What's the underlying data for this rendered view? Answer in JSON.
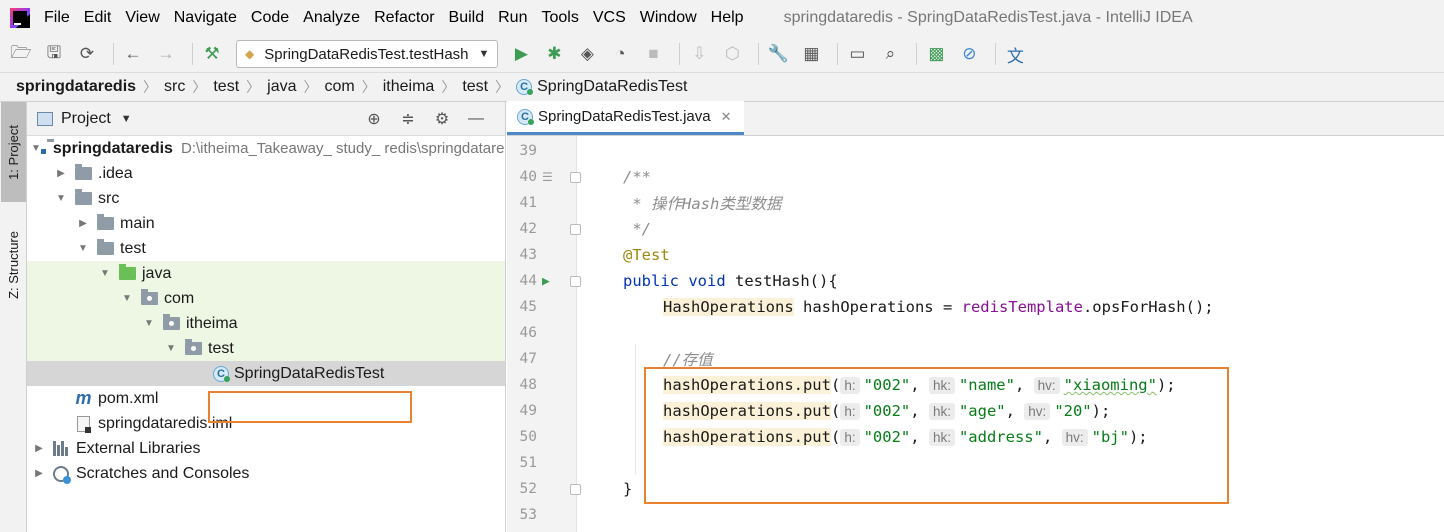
{
  "window_title": "springdataredis - SpringDataRedisTest.java - IntelliJ IDEA",
  "menu": [
    "File",
    "Edit",
    "View",
    "Navigate",
    "Code",
    "Analyze",
    "Refactor",
    "Build",
    "Run",
    "Tools",
    "VCS",
    "Window",
    "Help"
  ],
  "toolbar": {
    "run_config": "SpringDataRedisTest.testHash"
  },
  "breadcrumb": [
    "springdataredis",
    "src",
    "test",
    "java",
    "com",
    "itheima",
    "test",
    "SpringDataRedisTest"
  ],
  "tool_strip": {
    "project_tab": "1: Project",
    "structure_tab": "Z: Structure"
  },
  "project_panel": {
    "title": "Project",
    "tree": [
      {
        "label": "springdataredis",
        "path": "D:\\itheima_Takeaway_ study_ redis\\springdataredis"
      },
      {
        "label": ".idea"
      },
      {
        "label": "src"
      },
      {
        "label": "main"
      },
      {
        "label": "test"
      },
      {
        "label": "java"
      },
      {
        "label": "com"
      },
      {
        "label": "itheima"
      },
      {
        "label": "test"
      },
      {
        "label": "SpringDataRedisTest"
      },
      {
        "label": "pom.xml"
      },
      {
        "label": "springdataredis.iml"
      },
      {
        "label": "External Libraries"
      },
      {
        "label": "Scratches and Consoles"
      }
    ]
  },
  "editor": {
    "tab": "SpringDataRedisTest.java",
    "lines": [
      {
        "num": "39"
      },
      {
        "num": "40",
        "text": "/**"
      },
      {
        "num": "41",
        "text": " * 操作Hash类型数据"
      },
      {
        "num": "42",
        "text": " */"
      },
      {
        "num": "43",
        "text": "@Test"
      },
      {
        "num": "44",
        "kw1": "public",
        "kw2": "void",
        "text": " testHash(){"
      },
      {
        "num": "45",
        "type": "HashOperations",
        "mid": " hashOperations = ",
        "field": "redisTemplate",
        "tail": ".opsForHash();"
      },
      {
        "num": "46"
      },
      {
        "num": "47",
        "text": "//存值"
      },
      {
        "num": "48",
        "method": "hashOperations.put",
        "h": "h:",
        "k": "\"002\"",
        "hk": "hk:",
        "f": "\"name\"",
        "hv": "hv:",
        "v": "\"xiaoming\""
      },
      {
        "num": "49",
        "method": "hashOperations.put",
        "h": "h:",
        "k": "\"002\"",
        "hk": "hk:",
        "f": "\"age\"",
        "hv": "hv:",
        "v": "\"20\""
      },
      {
        "num": "50",
        "method": "hashOperations.put",
        "h": "h:",
        "k": "\"002\"",
        "hk": "hk:",
        "f": "\"address\"",
        "hv": "hv:",
        "v": "\"bj\""
      },
      {
        "num": "51"
      },
      {
        "num": "52",
        "text": "}"
      },
      {
        "num": "53"
      }
    ]
  },
  "icons": {
    "app": "intellij-logo",
    "toolbar": [
      "open-folder-icon",
      "save-icon",
      "sync-icon",
      "back-icon",
      "forward-icon",
      "build-hammer-icon",
      "run-icon",
      "debug-icon",
      "coverage-icon",
      "profile-icon",
      "stop-icon",
      "vcs-update-icon",
      "vcs-commit-icon",
      "settings-wrench-icon",
      "project-structure-icon",
      "terminal-icon",
      "search-icon",
      "sdk-icon",
      "power-save-icon",
      "translate-icon"
    ]
  },
  "colors": {
    "highlight_border": "#e8822f",
    "keyword": "#0033b3",
    "string": "#067d17",
    "annotation": "#9e880d",
    "comment": "#8c8c8c",
    "field": "#871094"
  }
}
